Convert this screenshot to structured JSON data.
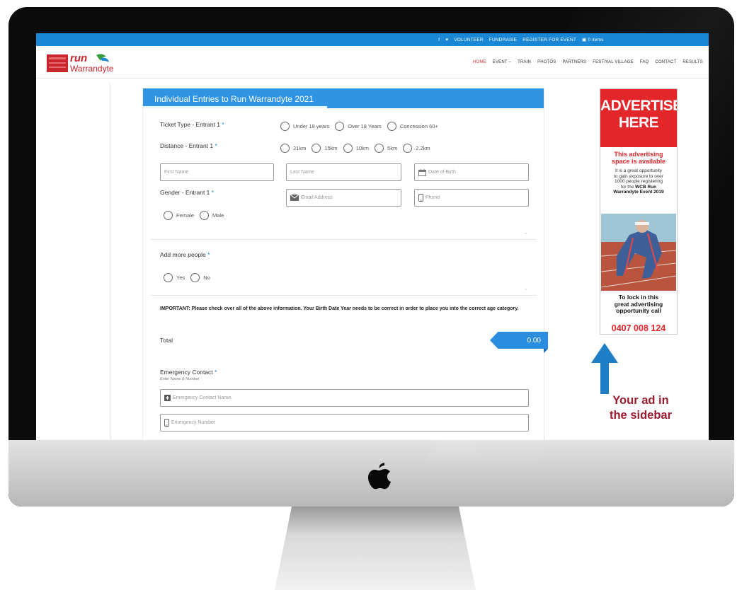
{
  "topbar": {
    "items": [
      "f",
      "♥",
      "VOLUNTEER",
      "FUNDRAISE",
      "REGISTER FOR EVENT",
      "0 items"
    ]
  },
  "logo": {
    "word": "run",
    "sub": "Warrandyte"
  },
  "nav": {
    "items": [
      "HOME",
      "EVENT –",
      "TRAIN",
      "PHOTOS",
      "PARTNERS",
      "FESTIVAL VILLAGE",
      "FAQ",
      "CONTACT",
      "RESULTS"
    ]
  },
  "form": {
    "title": "Individual Entries to Run Warrandyte 2021",
    "ticket_label": "Ticket Type - Entrant 1",
    "ticket_options": [
      "Under 18 years",
      "Over 18 Years",
      "Concession 60+"
    ],
    "distance_label": "Distance - Entrant 1",
    "distance_options": [
      "21km",
      "15km",
      "10km",
      "5km",
      "2.2km"
    ],
    "first_name_placeholder": "First Name",
    "last_name_placeholder": "Last Name",
    "dob_placeholder": "Date of Birth",
    "gender_label": "Gender - Entrant 1",
    "email_placeholder": "Email Address",
    "phone_placeholder": "Phone",
    "gender_options": [
      "Female",
      "Male"
    ],
    "more_label": "Add more people",
    "more_options": [
      "Yes",
      "No"
    ],
    "required_mark": "*",
    "important": "IMPORTANT: Please check over all of the above information. Your Birth Date Year needs to be correct in order to place you into the correct age category.",
    "total_label": "Total",
    "total_value": "0.00",
    "emergency_label": "Emergency Contact",
    "emergency_sub": "Enter Name & Number",
    "emergency_name_placeholder": "Emergency Contact Name",
    "emergency_number_placeholder": "Emergency Number"
  },
  "ad": {
    "headline_1": "ADVERTISE",
    "headline_2": "HERE",
    "available_1": "This advertising",
    "available_2": "space is available",
    "body_1": "It is a great opportunity",
    "body_2": "to gain exposure to over",
    "body_3": "1000 people registering",
    "body_4": "for the",
    "body_bold_1": "WCB Run",
    "body_bold_2": "Warrandyte Event 2019",
    "lock_1": "To lock in this",
    "lock_2": "great advertising",
    "lock_3": "opportunity call",
    "phone": "0407 008 124"
  },
  "annotation": {
    "line_1": "Your ad in",
    "line_2": "the sidebar",
    "arrow_color": "#1f7fc6",
    "text_color": "#9b1c2f"
  },
  "colors": {
    "brand_blue": "#1a86d6",
    "ad_red": "#e3262a"
  }
}
